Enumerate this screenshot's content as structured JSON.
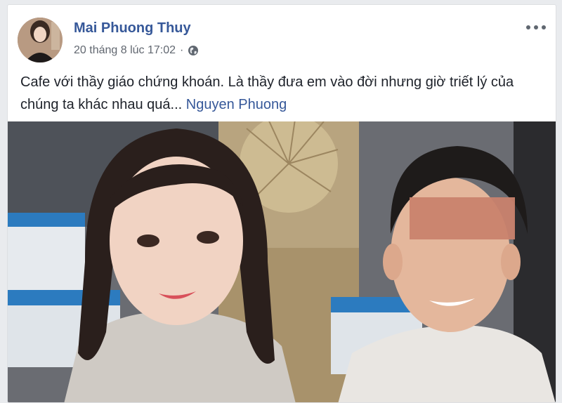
{
  "post": {
    "author": "Mai Phuong Thuy",
    "timestamp": "20 tháng 8 lúc 17:02",
    "separator": "·",
    "privacy_icon": "globe-icon",
    "more_icon": "more-options-icon",
    "text": "Cafe với thầy giáo chứng khoán. Là thầy đưa em vào đời nhưng giờ triết lý của chúng ta khác nhau quá...",
    "tagged_name": "Nguyen Phuong"
  },
  "colors": {
    "link": "#365899",
    "text": "#1d2129",
    "meta": "#616770",
    "background": "#e9ebee"
  }
}
